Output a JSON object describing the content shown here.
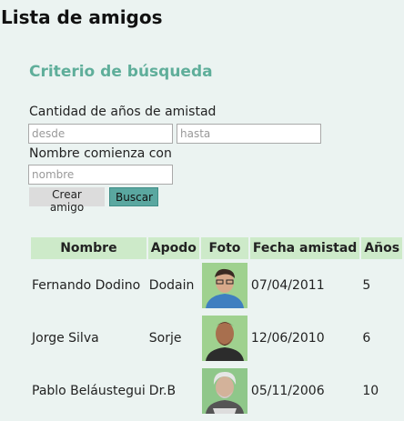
{
  "page": {
    "title": "Lista de amigos"
  },
  "search": {
    "title": "Criterio de búsqueda",
    "years_label": "Cantidad de años de amistad",
    "from_placeholder": "desde",
    "to_placeholder": "hasta",
    "name_label": "Nombre comienza con",
    "name_placeholder": "nombre",
    "create_button": "Crear amigo",
    "search_button": "Buscar"
  },
  "table": {
    "headers": [
      "Nombre",
      "Apodo",
      "Foto",
      "Fecha amistad",
      "Años"
    ],
    "rows": [
      {
        "name": "Fernando Dodino",
        "nickname": "Dodain",
        "photo": "photo-young-man-glasses",
        "date": "07/04/2011",
        "years": "5"
      },
      {
        "name": "Jorge Silva",
        "nickname": "Sorje",
        "photo": "photo-man-beard",
        "date": "12/06/2010",
        "years": "6"
      },
      {
        "name": "Pablo Beláustegui",
        "nickname": "Dr.B",
        "photo": "photo-grey-hair-man",
        "date": "05/11/2006",
        "years": "10"
      }
    ]
  },
  "colors": {
    "accent": "#5fae9a",
    "header_bg": "#cdeac9",
    "search_button": "#5aa7a0",
    "background": "#ebf3f1"
  }
}
